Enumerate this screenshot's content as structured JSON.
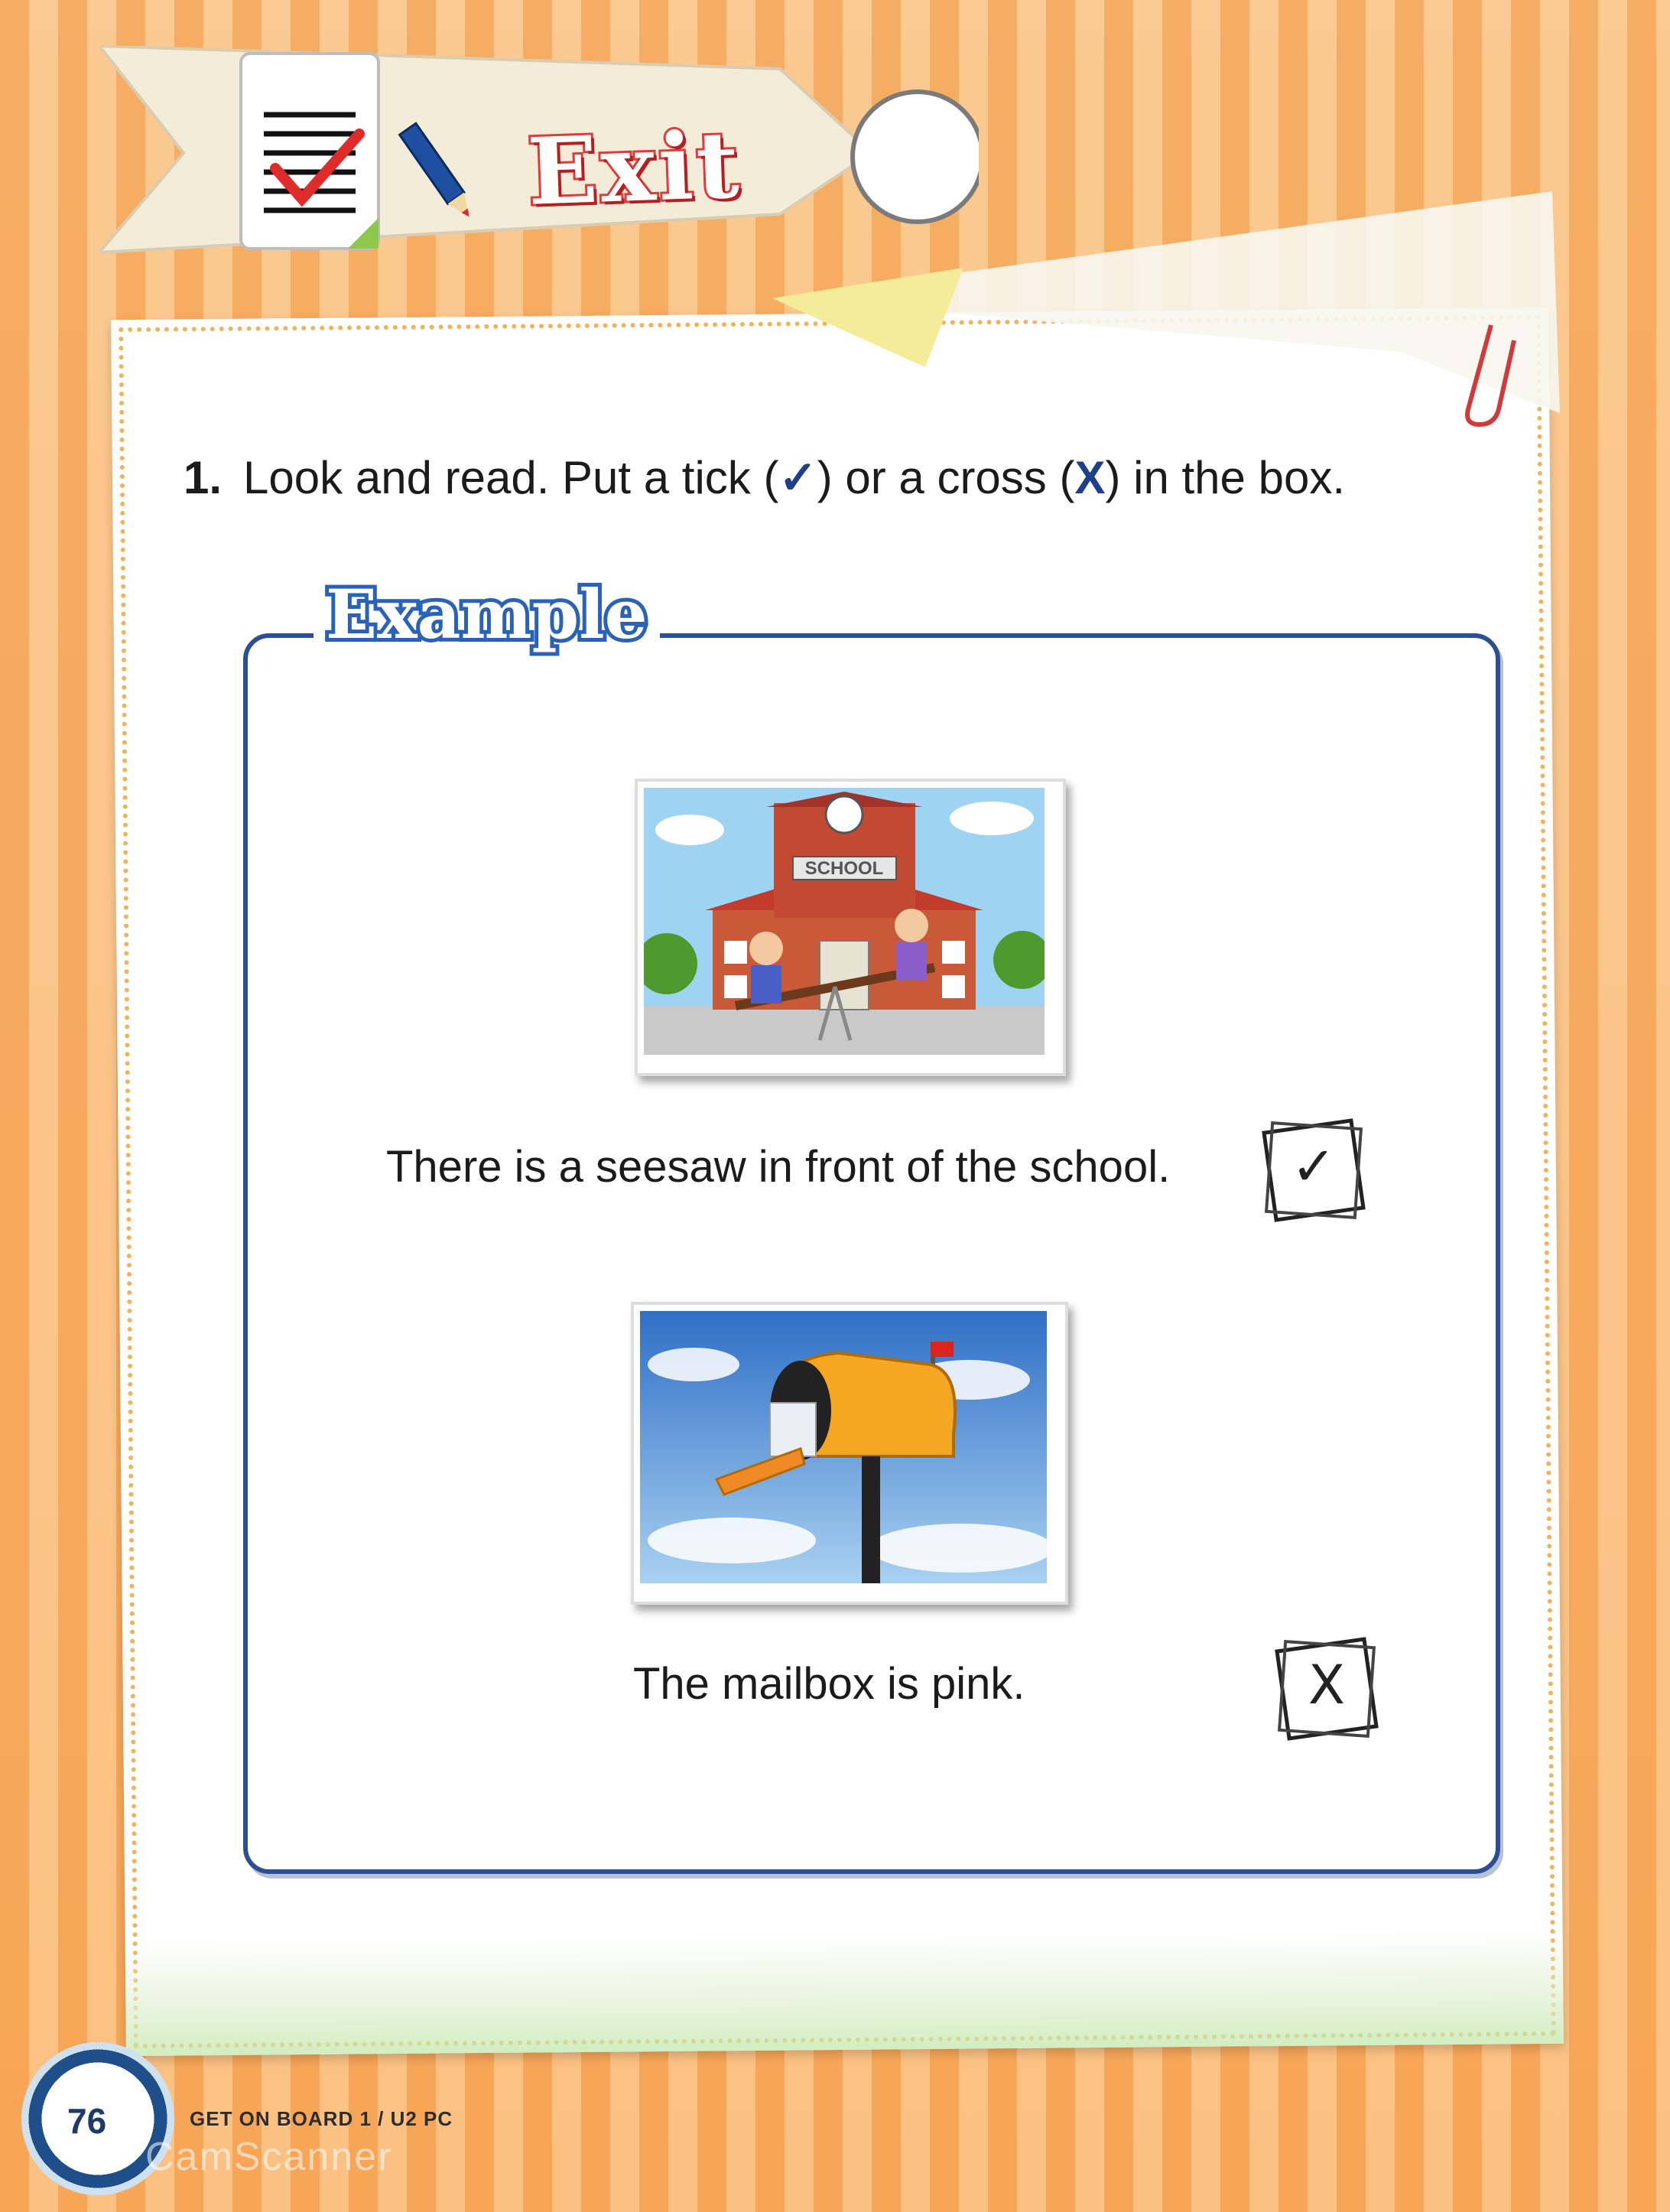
{
  "header": {
    "title": "Exit"
  },
  "exercise": {
    "number": "1.",
    "instruction_start": "Look and read. Put a tick (",
    "tick_symbol": "✓",
    "instruction_middle": ") or a cross (",
    "cross_symbol": "X",
    "instruction_end": ") in the box."
  },
  "example": {
    "label": "Example",
    "items": [
      {
        "picture_sign_text": "SCHOOL",
        "sentence": "There is a seesaw in front of the school.",
        "answer": "✓"
      },
      {
        "sentence": "The mailbox is pink.",
        "answer": "X"
      }
    ]
  },
  "footer": {
    "page_number": "76",
    "book_text": "GET ON BOARD 1 / U2 PC",
    "watermark": "CamScanner"
  },
  "colors": {
    "stripe_dark": "#f6a85a",
    "stripe_light": "#fbc68b",
    "box_border": "#2c4f93",
    "title_red": "#e23a3a"
  },
  "icons": [
    "document-check-icon",
    "pencil-icon",
    "paperclip-icon"
  ]
}
